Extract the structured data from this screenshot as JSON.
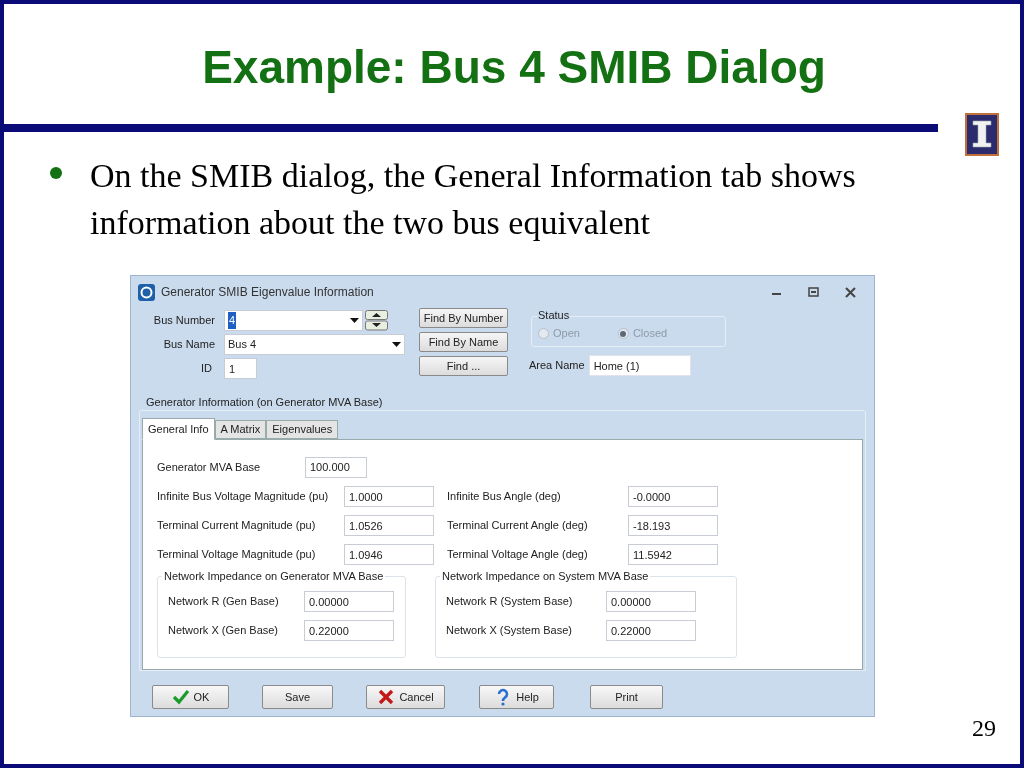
{
  "slide": {
    "title": "Example: Bus 4 SMIB Dialog",
    "bullets": [
      "On the SMIB dialog, the General Information tab shows information about the two bus equivalent"
    ],
    "page_number": "29"
  },
  "dialog": {
    "title": "Generator SMIB Eigenvalue Information",
    "bus_number": {
      "label": "Bus Number",
      "value": "4"
    },
    "bus_name": {
      "label": "Bus Name",
      "value": "Bus 4"
    },
    "id": {
      "label": "ID",
      "value": "1"
    },
    "find_buttons": [
      "Find By Number",
      "Find By Name",
      "Find ..."
    ],
    "status": {
      "label": "Status",
      "options": [
        {
          "label": "Open",
          "selected": false,
          "disabled": true
        },
        {
          "label": "Closed",
          "selected": true,
          "disabled": true
        }
      ]
    },
    "area_name": {
      "label": "Area Name",
      "value": "Home (1)"
    },
    "group_label": "Generator Information (on Generator MVA Base)",
    "tabs": [
      {
        "label": "General Info",
        "selected": true
      },
      {
        "label": "A Matrix",
        "selected": false
      },
      {
        "label": "Eigenvalues",
        "selected": false
      }
    ],
    "general_info": {
      "mva_base": {
        "label": "Generator MVA Base",
        "value": "100.000"
      },
      "rows": [
        {
          "label": "Infinite Bus Voltage Magnitude (pu)",
          "value": "1.0000",
          "label_2": "Infinite Bus Angle (deg)",
          "value_2": "-0.0000"
        },
        {
          "label": "Terminal Current Magnitude (pu)",
          "value": "1.0526",
          "label_2": "Terminal Current Angle (deg)",
          "value_2": "-18.193"
        },
        {
          "label": "Terminal Voltage Magnitude (pu)",
          "value": "1.0946",
          "label_2": "Terminal Voltage Angle (deg)",
          "value_2": "11.5942"
        }
      ],
      "impedance_groups": [
        {
          "title": "Network Impedance on Generator MVA Base",
          "rows": [
            {
              "label": "Network R (Gen Base)",
              "value": "0.00000"
            },
            {
              "label": "Network X (Gen Base)",
              "value": "0.22000"
            }
          ]
        },
        {
          "title": "Network Impedance on System MVA Base",
          "rows": [
            {
              "label": "Network R (System Base)",
              "value": "0.00000"
            },
            {
              "label": "Network X (System Base)",
              "value": "0.22000"
            }
          ]
        }
      ]
    },
    "buttons": [
      {
        "label": "OK",
        "kind": "check"
      },
      {
        "label": "Save",
        "kind": "plain"
      },
      {
        "label": "Cancel",
        "kind": "cross"
      },
      {
        "label": "Help",
        "kind": "help"
      },
      {
        "label": "Print",
        "kind": "plain"
      }
    ]
  }
}
